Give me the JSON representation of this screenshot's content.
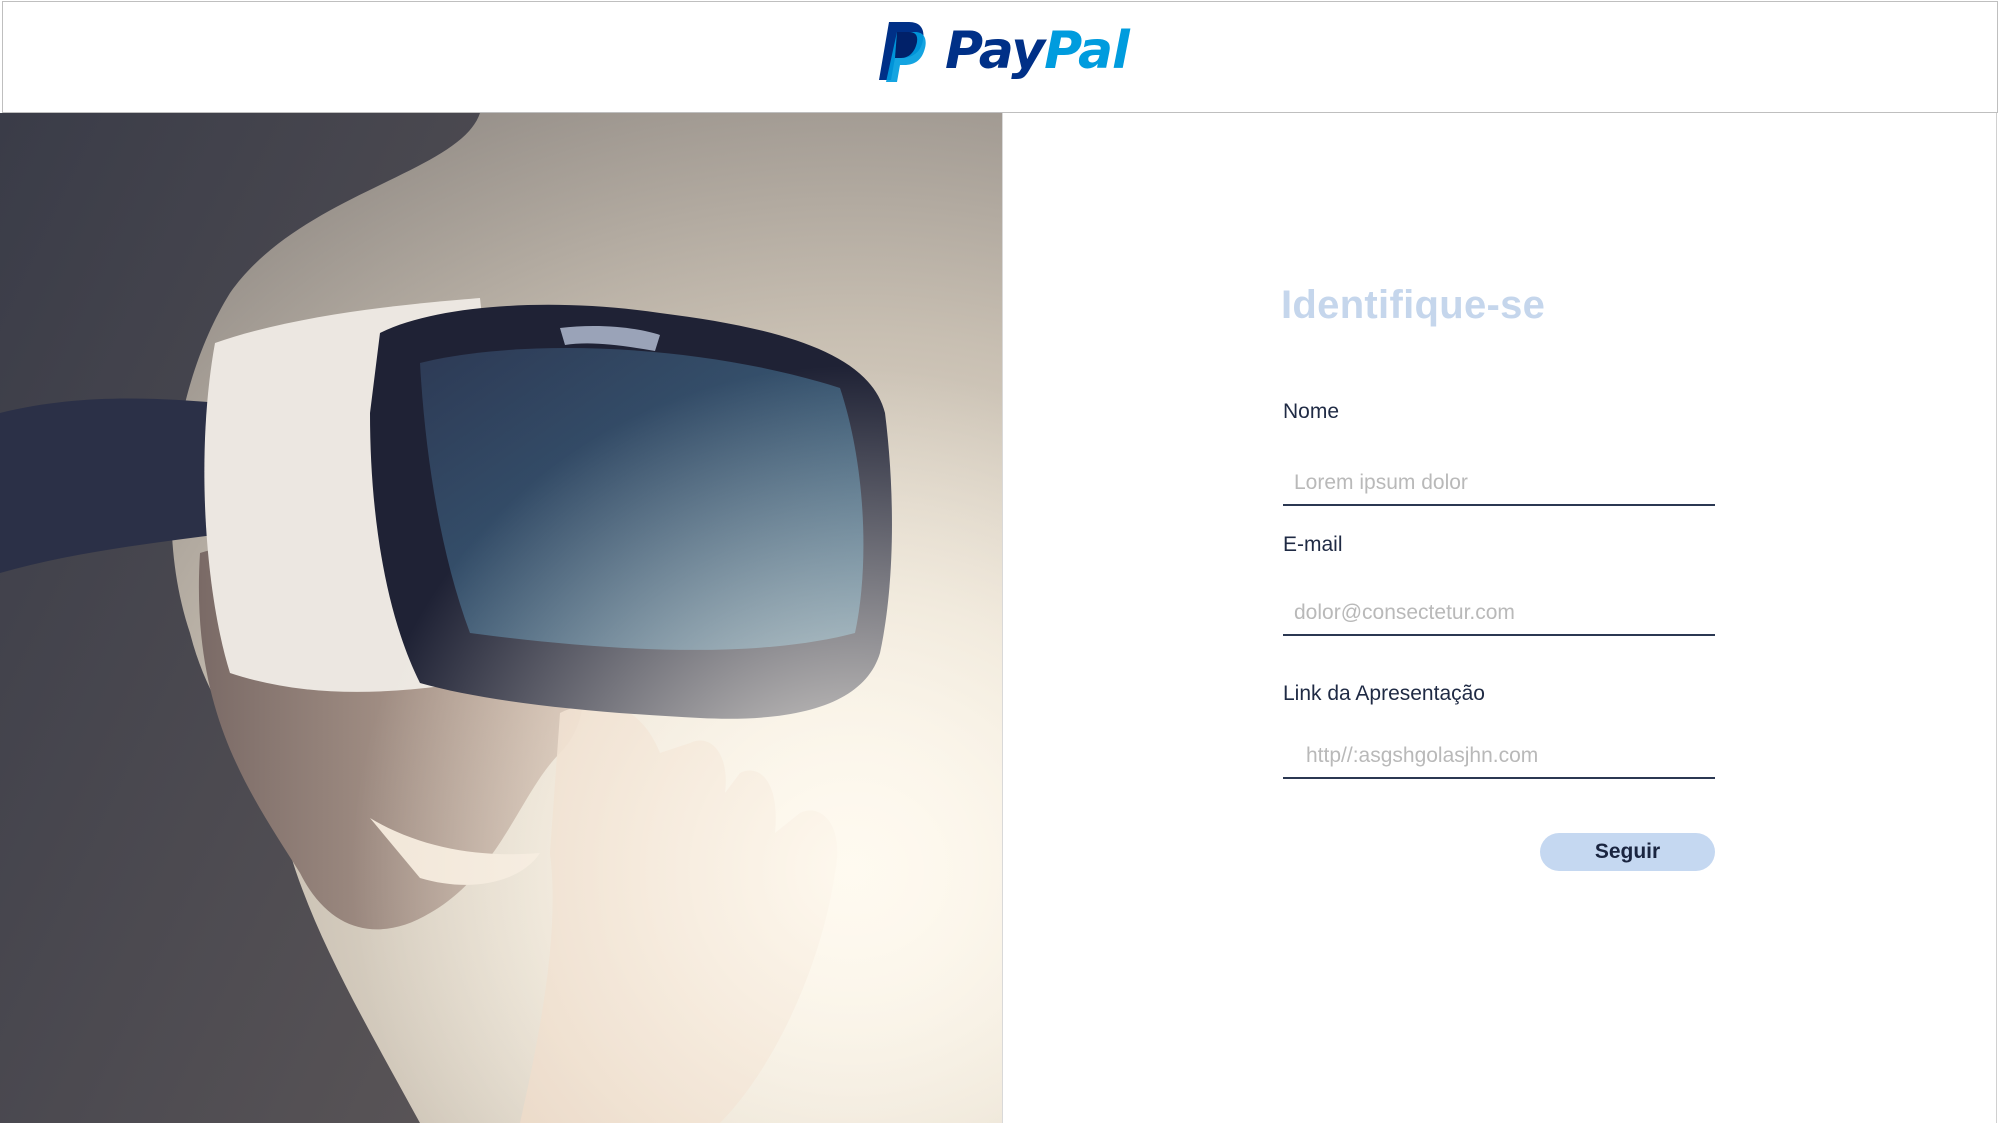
{
  "header": {
    "logo": {
      "word_part1": "Pay",
      "word_part2": "Pal",
      "icon": "paypal-logo-icon",
      "color_dark": "#003087",
      "color_light": "#009cde"
    }
  },
  "hero": {
    "image": "woman-with-vr-headset-photo"
  },
  "form": {
    "title": "Identifique-se",
    "fields": [
      {
        "label": "Nome",
        "value": "",
        "placeholder": "Lorem ipsum dolor"
      },
      {
        "label": "E-mail",
        "value": "",
        "placeholder": "dolor@consectetur.com"
      },
      {
        "label": "Link da Apresentação",
        "value": "",
        "placeholder": "http//:asgshgolasjhn.com"
      }
    ],
    "submit_label": "Seguir"
  },
  "colors": {
    "title": "#c5d6ec",
    "button": "#c5d8f1",
    "input_underline": "#2b3852"
  }
}
